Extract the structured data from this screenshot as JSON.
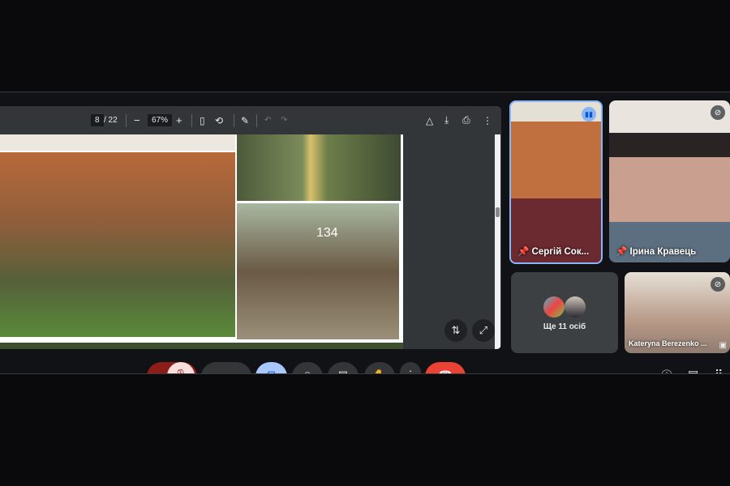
{
  "pdf_viewer": {
    "current_page": "8",
    "total_pages": "/ 22",
    "zoom": "67%",
    "zoom_out": "−",
    "zoom_in": "+"
  },
  "participants": [
    {
      "name": "Сергій Сок...",
      "speaking": true,
      "pinned": true
    },
    {
      "name": "Ірина Кравець",
      "pinned": true,
      "muted": true
    },
    {
      "name": "Kateryna Berezenko ...",
      "muted": true
    }
  ],
  "others": {
    "label": "Ще 11 осіб"
  },
  "photo_labels": {
    "tree_number": "134"
  },
  "colors": {
    "accent": "#8ab4f8",
    "end_call": "#ea4335",
    "mic_off": "#f9dedc"
  }
}
